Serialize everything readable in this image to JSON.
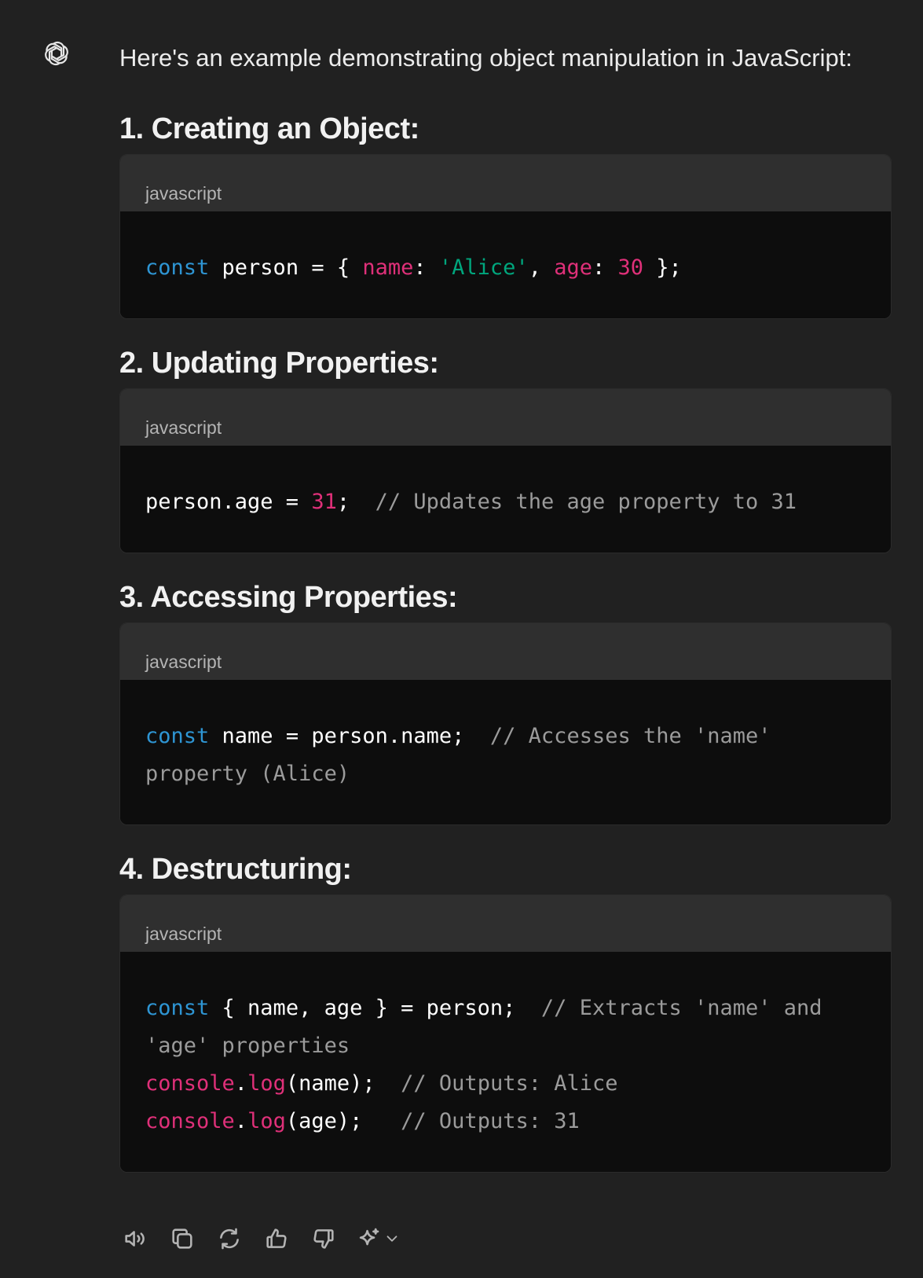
{
  "message": {
    "intro": "Here's an example demonstrating object manipulation in JavaScript:"
  },
  "sections": [
    {
      "heading": "1. Creating an Object:",
      "language": "javascript",
      "lines": [
        [
          {
            "t": "kw",
            "v": "const"
          },
          {
            "t": "plain",
            "v": " person = { "
          },
          {
            "t": "prop",
            "v": "name"
          },
          {
            "t": "plain",
            "v": ": "
          },
          {
            "t": "str",
            "v": "'Alice'"
          },
          {
            "t": "plain",
            "v": ", "
          },
          {
            "t": "prop",
            "v": "age"
          },
          {
            "t": "plain",
            "v": ": "
          },
          {
            "t": "num",
            "v": "30"
          },
          {
            "t": "plain",
            "v": " };"
          }
        ]
      ]
    },
    {
      "heading": "2. Updating Properties:",
      "language": "javascript",
      "lines": [
        [
          {
            "t": "plain",
            "v": "person.age = "
          },
          {
            "t": "num",
            "v": "31"
          },
          {
            "t": "plain",
            "v": ";  "
          },
          {
            "t": "com",
            "v": "// Updates the age property to 31"
          }
        ]
      ]
    },
    {
      "heading": "3. Accessing Properties:",
      "language": "javascript",
      "lines": [
        [
          {
            "t": "kw",
            "v": "const"
          },
          {
            "t": "plain",
            "v": " name = person.name;  "
          },
          {
            "t": "com",
            "v": "// Accesses the 'name'"
          }
        ],
        [
          {
            "t": "com",
            "v": "property (Alice)"
          }
        ]
      ]
    },
    {
      "heading": "4. Destructuring:",
      "language": "javascript",
      "lines": [
        [
          {
            "t": "kw",
            "v": "const"
          },
          {
            "t": "plain",
            "v": " { name, age } = person;  "
          },
          {
            "t": "com",
            "v": "// Extracts 'name' and"
          }
        ],
        [
          {
            "t": "com",
            "v": "'age' properties"
          }
        ],
        [
          {
            "t": "prop",
            "v": "console"
          },
          {
            "t": "plain",
            "v": "."
          },
          {
            "t": "prop",
            "v": "log"
          },
          {
            "t": "plain",
            "v": "(name);  "
          },
          {
            "t": "com",
            "v": "// Outputs: Alice"
          }
        ],
        [
          {
            "t": "prop",
            "v": "console"
          },
          {
            "t": "plain",
            "v": "."
          },
          {
            "t": "prop",
            "v": "log"
          },
          {
            "t": "plain",
            "v": "(age);   "
          },
          {
            "t": "com",
            "v": "// Outputs: 31"
          }
        ]
      ]
    }
  ],
  "actions": [
    {
      "name": "read-aloud-button",
      "icon": "speaker-icon"
    },
    {
      "name": "copy-button",
      "icon": "copy-icon"
    },
    {
      "name": "regenerate-button",
      "icon": "refresh-icon"
    },
    {
      "name": "thumbs-up-button",
      "icon": "thumbs-up-icon"
    },
    {
      "name": "thumbs-down-button",
      "icon": "thumbs-down-icon"
    },
    {
      "name": "change-model-button",
      "icon": "sparkle-icon"
    }
  ],
  "colors": {
    "background": "#212121",
    "code_header": "#2f2f2f",
    "code_body": "#0d0d0d",
    "keyword": "#2e95d3",
    "property": "#df3079",
    "string": "#00a67d",
    "comment": "#9b9b9b"
  }
}
